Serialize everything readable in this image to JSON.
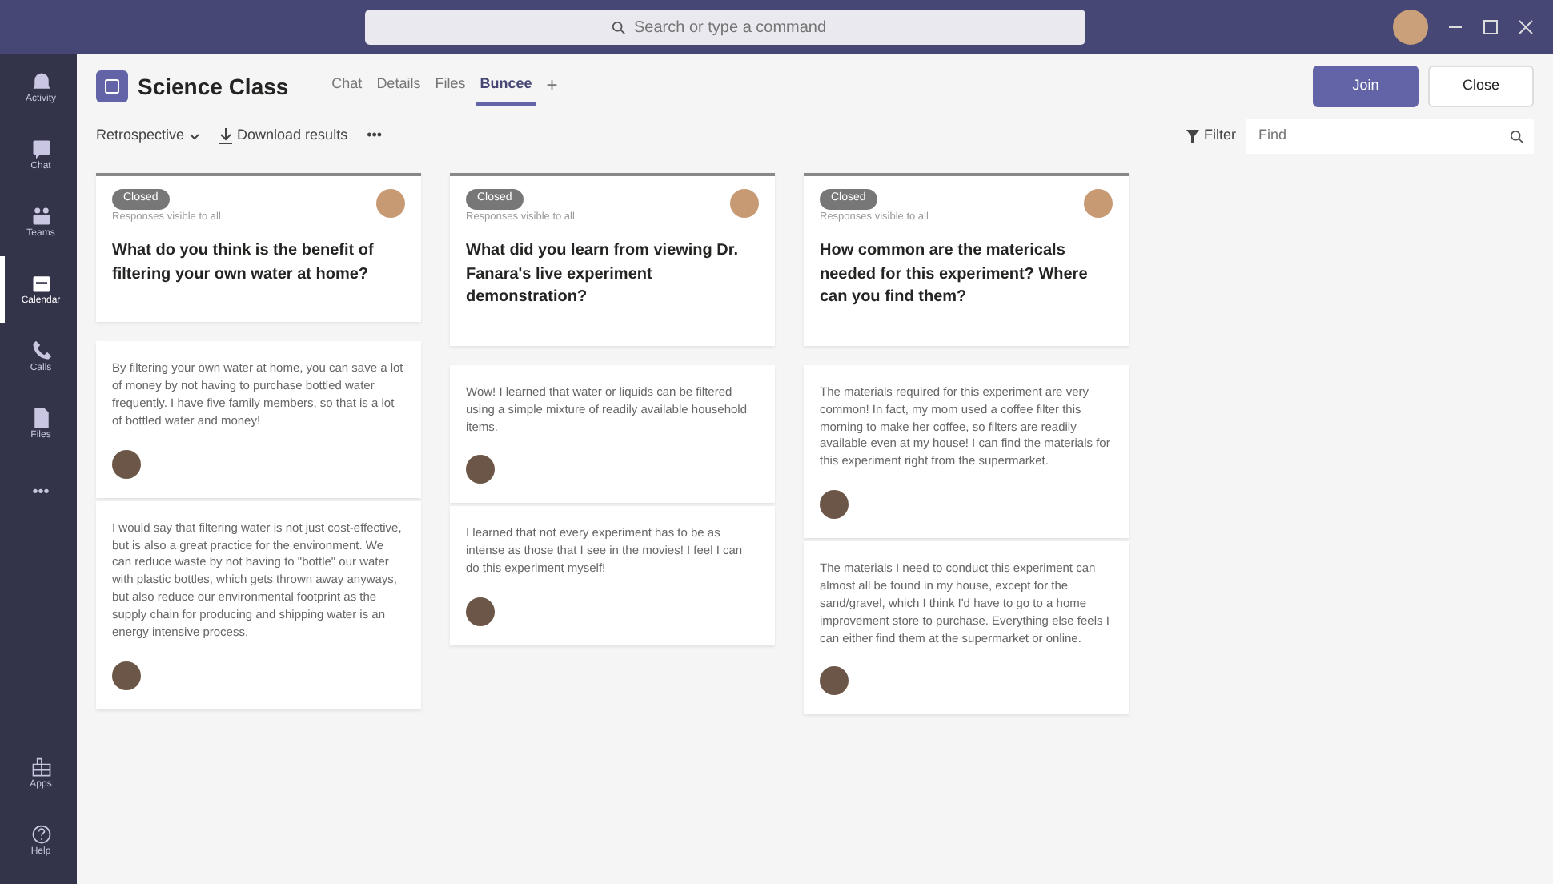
{
  "search": {
    "placeholder": "Search or type a command"
  },
  "sidebar": {
    "items": [
      {
        "kind": "bell",
        "label": "Activity",
        "selected": false
      },
      {
        "kind": "chat",
        "label": "Chat",
        "selected": false
      },
      {
        "kind": "teams",
        "label": "Teams",
        "selected": false
      },
      {
        "kind": "calendar",
        "label": "Calendar",
        "selected": true
      },
      {
        "kind": "call",
        "label": "Calls",
        "selected": false
      },
      {
        "kind": "file",
        "label": "Files",
        "selected": false
      },
      {
        "kind": "more",
        "label": "•••",
        "selected": false
      }
    ],
    "bottom": [
      {
        "kind": "apps",
        "label": "Apps"
      },
      {
        "kind": "help",
        "label": "Help"
      }
    ]
  },
  "header": {
    "title": "Science Class",
    "tabs": [
      {
        "label": "Chat",
        "selected": false
      },
      {
        "label": "Details",
        "selected": false
      },
      {
        "label": "Files",
        "selected": false
      },
      {
        "label": "Buncee",
        "selected": true
      }
    ],
    "add": "+",
    "buttons": [
      {
        "label": "Join",
        "primary": true
      },
      {
        "label": "Close",
        "primary": false
      }
    ]
  },
  "toolbar": {
    "view": "Retrospective",
    "download": "Download results",
    "more": "•••",
    "filter": "Filter",
    "find": {
      "placeholder": "Find"
    }
  },
  "columns": [
    {
      "status": "Closed",
      "visibility": "Responses visible to all",
      "question": "What do you think is the benefit of filtering your own water at home?",
      "responses": [
        {
          "text": "By filtering your own water at home, you can save a lot of money by not having to purchase bottled water frequently. I have five family members, so that is a lot of bottled water and money!"
        },
        {
          "text": "I would say that filtering water is not just cost-effective, but is also a great practice for the environment. We can reduce waste by not having to \"bottle\" our water with plastic bottles, which gets thrown away anyways, but also reduce our environmental footprint as the supply chain for producing and shipping water is an energy intensive process."
        }
      ]
    },
    {
      "status": "Closed",
      "visibility": "Responses visible to all",
      "question": "What did you learn from viewing Dr. Fanara's live experiment demonstration?",
      "responses": [
        {
          "text": "Wow! I learned that water or liquids can be filtered using a simple mixture of readily available household items."
        },
        {
          "text": "I learned that not every experiment has to be as intense as those that I see in the movies! I feel I can do this experiment myself!"
        }
      ]
    },
    {
      "status": "Closed",
      "visibility": "Responses visible to all",
      "question": "How common are the matericals needed for this experiment? Where can you find them?",
      "responses": [
        {
          "text": "The materials required for this experiment are very common! In fact, my mom used a coffee filter this morning to make her coffee, so filters are readily available even at my house! I can find the materials for this experiment right from the supermarket."
        },
        {
          "text": "The materials I need to conduct this experiment can almost all be found in my house, except for the sand/gravel, which I think I'd have to go to a home improvement store to purchase. Everything else feels I can either find them at the supermarket or online."
        }
      ]
    }
  ]
}
